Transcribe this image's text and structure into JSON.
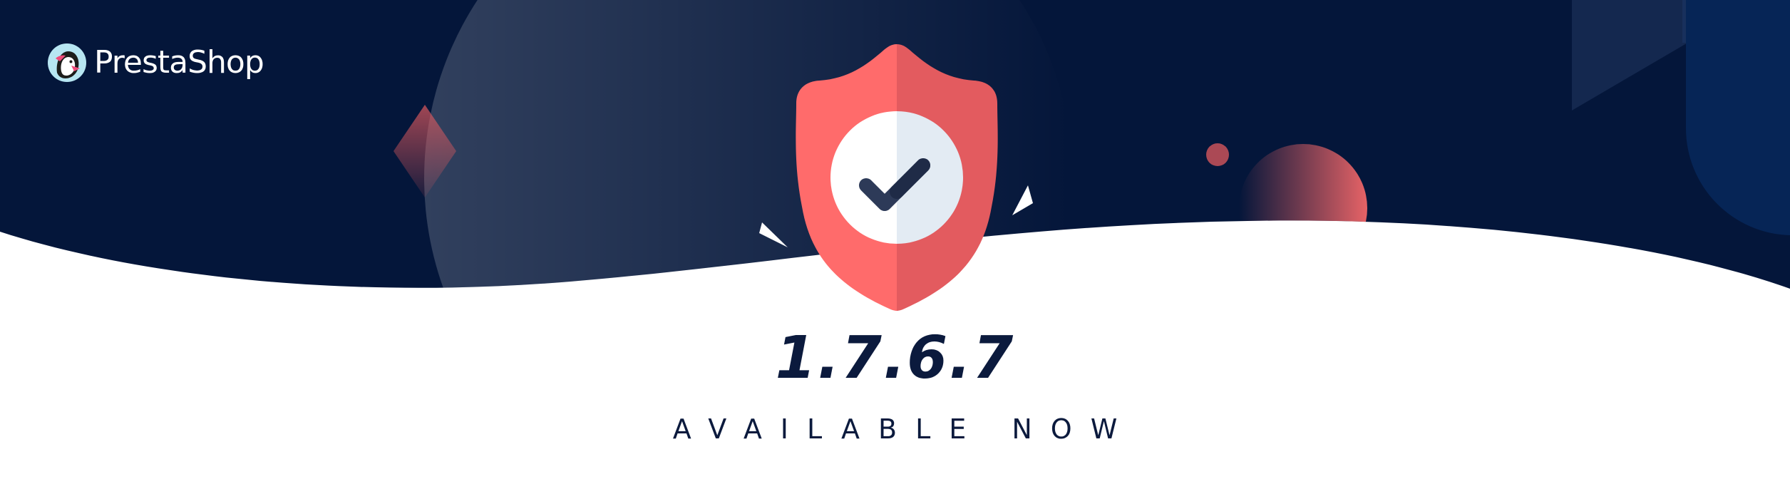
{
  "brand": {
    "name": "PrestaShop",
    "logo_icon": "puffin-logo-icon"
  },
  "release": {
    "version": "1.7.6.7",
    "tagline": "AVAILABLE NOW"
  },
  "colors": {
    "navy": "#04163a",
    "shield_left": "#ff6b6b",
    "shield_right": "#e35b5f",
    "text": "#0b1a3d",
    "white": "#ffffff"
  },
  "icons": [
    "shield-icon",
    "checkmark-icon"
  ]
}
